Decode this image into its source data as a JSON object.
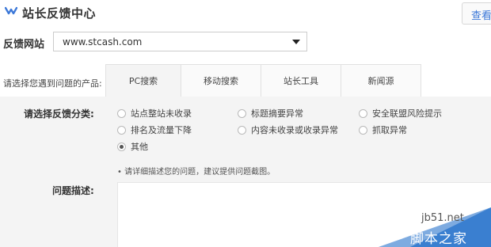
{
  "header": {
    "title": "站长反馈中心",
    "view_button": "查看",
    "logo_icon": "check-arrow-icon",
    "accent": "#3c78d8"
  },
  "site": {
    "label": "反馈网站",
    "selected": "www.stcash.com"
  },
  "product": {
    "label": "请选择您遇到问题的产品:",
    "tabs": [
      "PC搜索",
      "移动搜索",
      "站长工具",
      "新闻源"
    ],
    "active_tab": "PC搜索"
  },
  "feedback": {
    "category_label": "请选择反馈分类:",
    "options": [
      "站点整站未收录",
      "标题摘要异常",
      "安全联盟风险提示",
      "排名及流量下降",
      "内容未收录或收录异常",
      "抓取异常",
      "其他"
    ],
    "selected": "其他",
    "hint": "请详细描述您的问题，建议提供问题截图。",
    "desc_label": "问题描述:"
  },
  "watermark": {
    "url": "jb51.net",
    "name": "脚本之家",
    "color": "#3a7fd0"
  }
}
